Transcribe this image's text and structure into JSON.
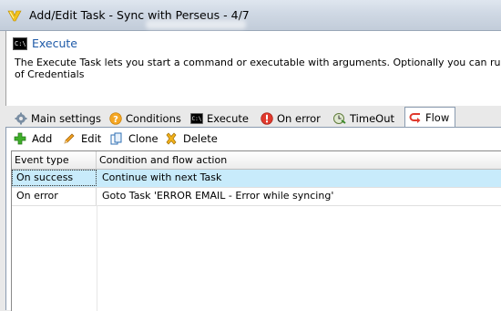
{
  "window": {
    "title": "Add/Edit Task - Sync with Perseus - 4/7"
  },
  "header": {
    "title": "Execute",
    "description_line1": "The Execute Task lets you start a command or executable with arguments. Optionally you can run the proc",
    "description_line2": "of Credentials"
  },
  "tabs": [
    {
      "label": "Main settings",
      "icon": "gear-icon"
    },
    {
      "label": "Conditions",
      "icon": "question-icon"
    },
    {
      "label": "Execute",
      "icon": "console-icon"
    },
    {
      "label": "On error",
      "icon": "error-icon"
    },
    {
      "label": "TimeOut",
      "icon": "clock-icon"
    },
    {
      "label": "Flow",
      "icon": "flow-icon",
      "active": true
    }
  ],
  "toolbar": {
    "add_label": "Add",
    "edit_label": "Edit",
    "clone_label": "Clone",
    "delete_label": "Delete"
  },
  "grid": {
    "columns": [
      "Event type",
      "Condition and flow action"
    ],
    "rows": [
      {
        "event": "On success",
        "action": "Continue with next Task",
        "selected": true
      },
      {
        "event": "On error",
        "action": "Goto Task 'ERROR EMAIL - Error while syncing'"
      }
    ]
  },
  "colors": {
    "accent": "#1e5aa8",
    "selection": "#c8ebfb"
  }
}
